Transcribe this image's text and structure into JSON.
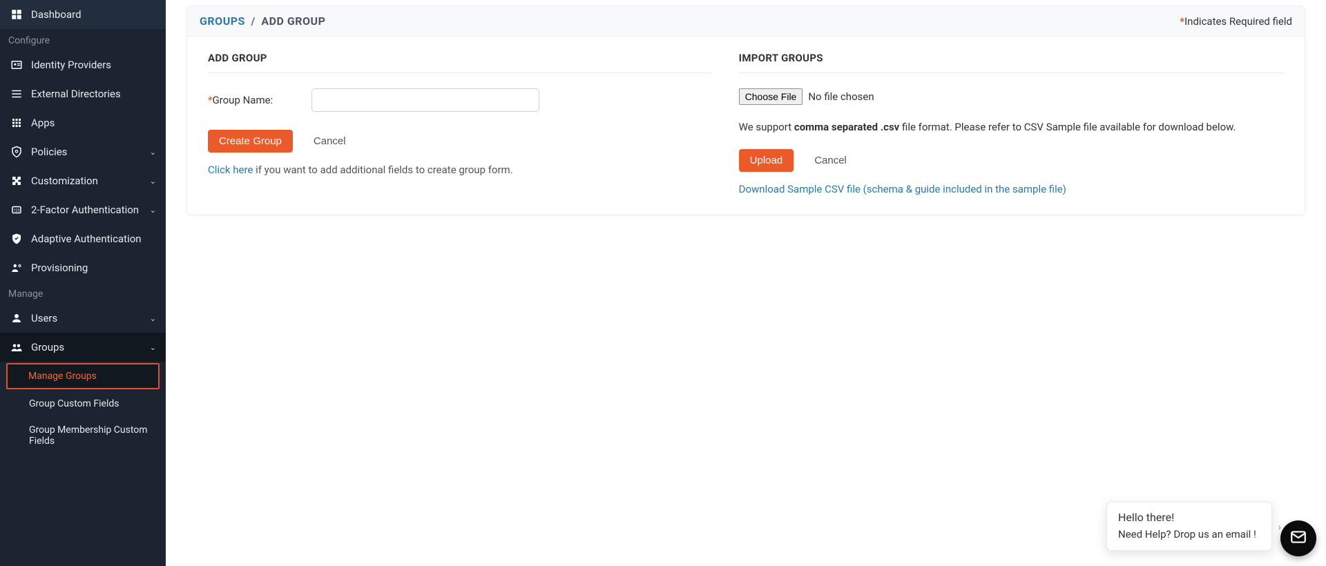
{
  "sidebar": {
    "dashboard": "Dashboard",
    "section_configure": "Configure",
    "identity_providers": "Identity Providers",
    "external_directories": "External Directories",
    "apps": "Apps",
    "policies": "Policies",
    "customization": "Customization",
    "two_factor": "2-Factor Authentication",
    "adaptive_auth": "Adaptive Authentication",
    "provisioning": "Provisioning",
    "section_manage": "Manage",
    "users": "Users",
    "groups": "Groups",
    "groups_sub": {
      "manage_groups": "Manage Groups",
      "group_custom_fields": "Group Custom Fields",
      "group_membership": "Group Membership Custom Fields"
    }
  },
  "header": {
    "bc_groups": "GROUPS",
    "bc_sep": "/",
    "bc_tail": "ADD GROUP",
    "required_note": "Indicates Required field"
  },
  "left": {
    "title": "ADD GROUP",
    "group_name_label": "Group Name:",
    "create_btn": "Create Group",
    "cancel_btn": "Cancel",
    "help_link": "Click here",
    "help_rest": " if you want to add additional fields to create group form."
  },
  "right": {
    "title": "IMPORT GROUPS",
    "choose_file_btn": "Choose File",
    "no_file": "No file chosen",
    "support_pre": "We support ",
    "support_bold": "comma separated .csv",
    "support_post": " file format. Please refer to CSV Sample file available for download below.",
    "upload_btn": "Upload",
    "cancel_btn": "Cancel",
    "download_link": "Download Sample CSV file (schema & guide included in the sample file)"
  },
  "chat": {
    "line1": "Hello there!",
    "line2": "Need Help? Drop us an email !"
  }
}
